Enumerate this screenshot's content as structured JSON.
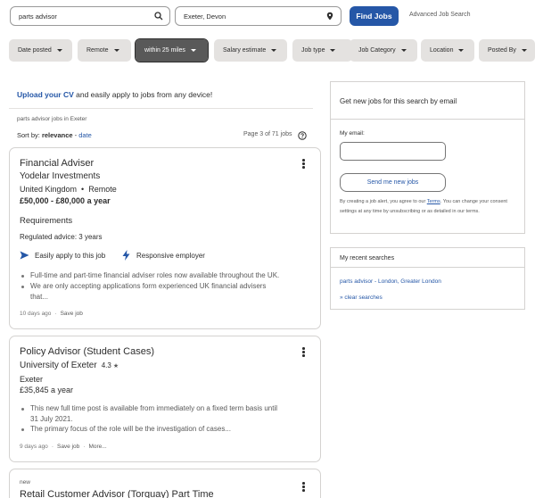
{
  "search": {
    "what_value": "parts advisor",
    "where_value": "Exeter, Devon",
    "find_label": "Find Jobs",
    "advanced_label": "Advanced Job Search"
  },
  "filters": [
    {
      "label": "Date posted",
      "active": false
    },
    {
      "label": "Remote",
      "active": false
    },
    {
      "label": "within 25 miles",
      "active": true
    },
    {
      "label": "Salary estimate",
      "active": false
    },
    {
      "label": "Job type",
      "active": false
    },
    {
      "label": "Job Category",
      "active": false
    },
    {
      "label": "Location",
      "active": false
    },
    {
      "label": "Posted By",
      "active": false
    }
  ],
  "upload": {
    "link": "Upload your CV",
    "rest": " and easily apply to jobs from any device!"
  },
  "results": {
    "jobs_in": "parts advisor jobs in Exeter",
    "sort_label": "Sort by: ",
    "sort_active": "relevance",
    "sort_sep": " - ",
    "sort_other": "date",
    "page_info": "Page 3 of 71 jobs"
  },
  "jobs": [
    {
      "title": "Financial Adviser",
      "company": "Yodelar Investments",
      "location": "United Kingdom",
      "remote": "Remote",
      "salary": "£50,000 - £80,000 a year",
      "requirements_heading": "Requirements",
      "requirement": "Regulated advice: 3 years",
      "feature1": "Easily apply to this job",
      "feature2": "Responsive employer",
      "snippet1": "Full-time and part-time financial adviser roles now available throughout the UK.",
      "snippet2a": "We are only accepting applications form experienced UK financial advisers",
      "snippet2b": "that...",
      "posted": "10 days ago",
      "save": "Save job"
    },
    {
      "title": "Policy Advisor (Student Cases)",
      "company": "University of Exeter",
      "rating": "4.3",
      "location": "Exeter",
      "salary": "£35,845 a year",
      "snippet1a": "This new full time post is available from immediately on a fixed term basis until",
      "snippet1b": "31 July 2021.",
      "snippet2": "The primary focus of the role will be the investigation of cases...",
      "posted": "9 days ago",
      "save": "Save job",
      "more": "More..."
    },
    {
      "tag": "new",
      "title": "Retail Customer Advisor (Torquay) Part Time"
    }
  ],
  "alert_panel": {
    "heading": "Get new jobs for this search by email",
    "email_label": "My email:",
    "send_label": "Send me new jobs",
    "fine1": "By creating a job alert, you agree to our ",
    "terms": "Terms",
    "fine2": ". You can change your consent settings at any time by unsubscribing or as detailed in our terms."
  },
  "recent_panel": {
    "heading": "My recent searches",
    "item": "parts advisor - London, Greater London",
    "clear": "» clear searches"
  },
  "colors": {
    "accent": "#2557a7",
    "chip_bg": "#e4e2e0",
    "chip_active": "#595959"
  }
}
